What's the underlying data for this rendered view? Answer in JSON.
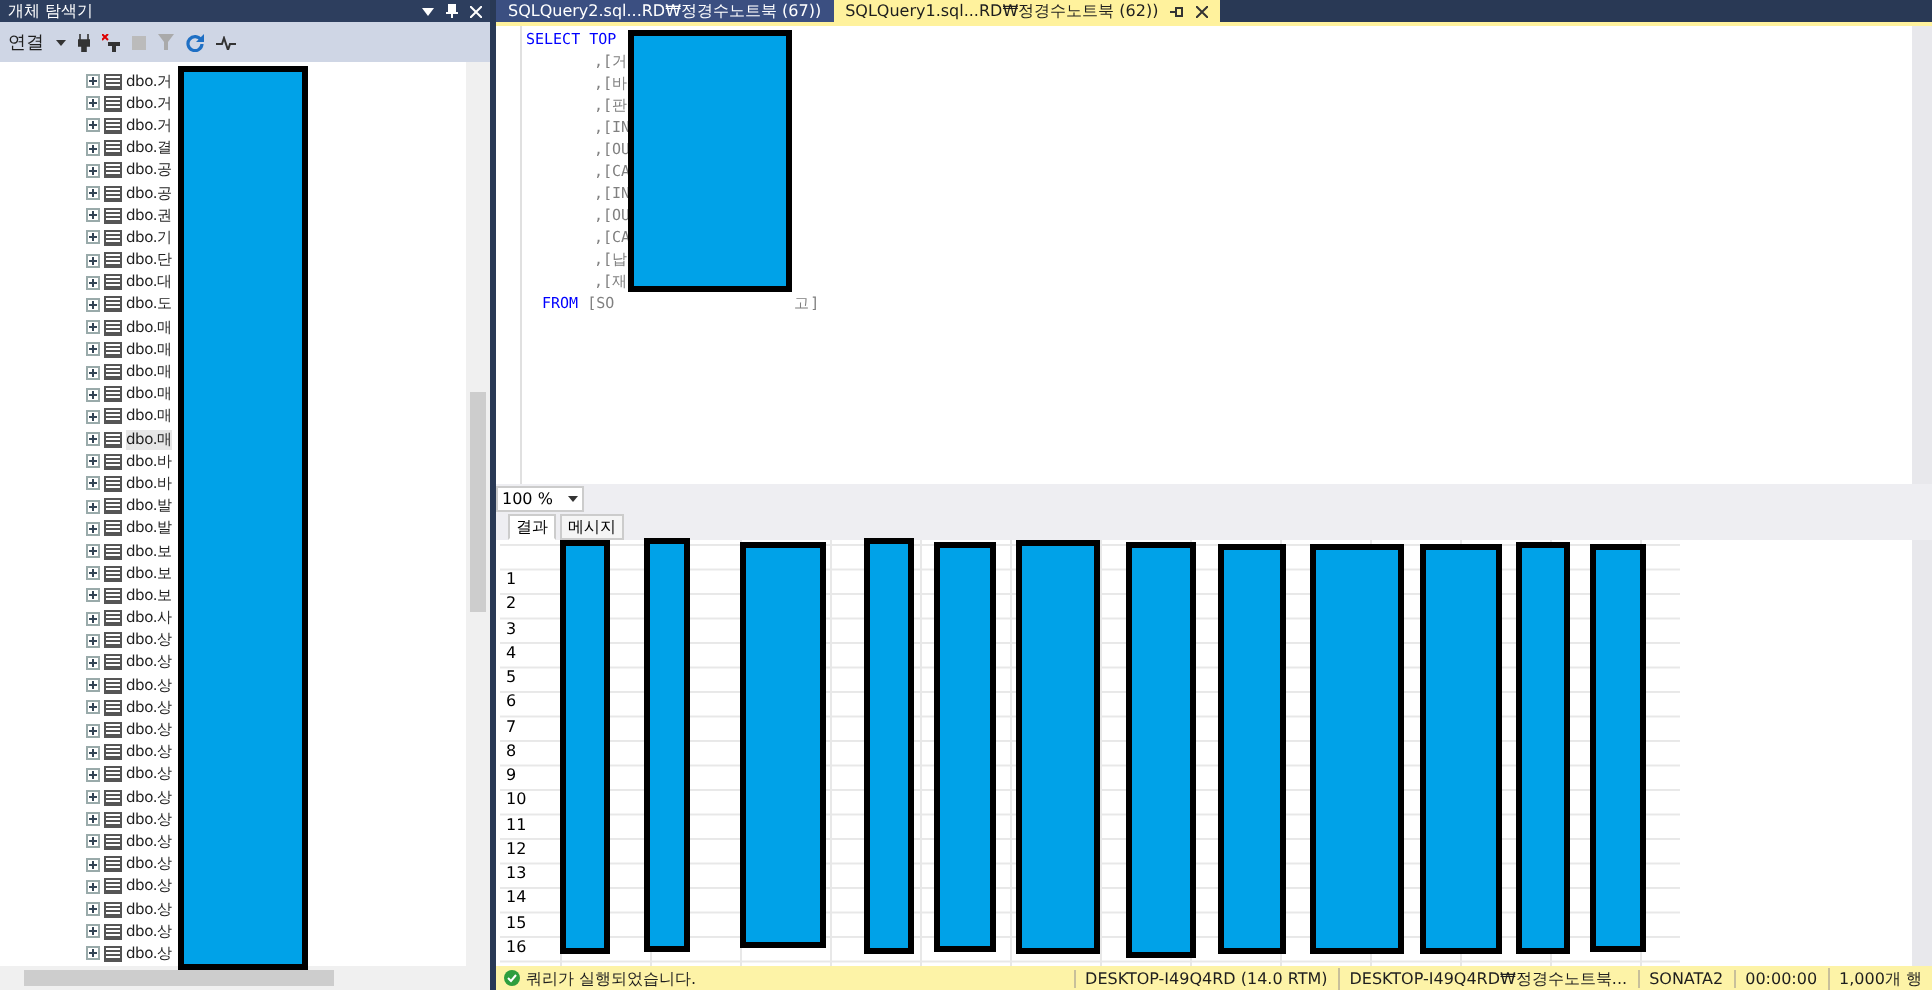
{
  "object_explorer": {
    "title": "개체 탐색기",
    "connect_label": "연결",
    "tree_items": [
      {
        "label": "dbo.거",
        "selected": false
      },
      {
        "label": "dbo.거",
        "selected": false
      },
      {
        "label": "dbo.거",
        "selected": false
      },
      {
        "label": "dbo.결",
        "selected": false
      },
      {
        "label": "dbo.공",
        "selected": false
      },
      {
        "label": "dbo.공",
        "selected": false
      },
      {
        "label": "dbo.권",
        "selected": false
      },
      {
        "label": "dbo.기",
        "selected": false
      },
      {
        "label": "dbo.단",
        "selected": false
      },
      {
        "label": "dbo.대",
        "selected": false
      },
      {
        "label": "dbo.도",
        "selected": false
      },
      {
        "label": "dbo.매",
        "selected": false
      },
      {
        "label": "dbo.매",
        "selected": false
      },
      {
        "label": "dbo.매",
        "selected": false
      },
      {
        "label": "dbo.매",
        "selected": false
      },
      {
        "label": "dbo.매",
        "selected": false
      },
      {
        "label": "dbo.매",
        "selected": true
      },
      {
        "label": "dbo.바",
        "selected": false
      },
      {
        "label": "dbo.바",
        "selected": false
      },
      {
        "label": "dbo.발",
        "selected": false
      },
      {
        "label": "dbo.발",
        "selected": false
      },
      {
        "label": "dbo.보",
        "selected": false
      },
      {
        "label": "dbo.보",
        "selected": false
      },
      {
        "label": "dbo.보",
        "selected": false
      },
      {
        "label": "dbo.사",
        "selected": false
      },
      {
        "label": "dbo.상",
        "selected": false
      },
      {
        "label": "dbo.상",
        "selected": false
      },
      {
        "label": "dbo.상",
        "selected": false
      },
      {
        "label": "dbo.상",
        "selected": false
      },
      {
        "label": "dbo.상",
        "selected": false
      },
      {
        "label": "dbo.상",
        "selected": false
      },
      {
        "label": "dbo.상",
        "selected": false
      },
      {
        "label": "dbo.상",
        "selected": false
      },
      {
        "label": "dbo.상",
        "selected": false
      },
      {
        "label": "dbo.상",
        "selected": false
      },
      {
        "label": "dbo.상",
        "selected": false
      },
      {
        "label": "dbo.상",
        "selected": false
      },
      {
        "label": "dbo.상",
        "selected": false
      },
      {
        "label": "dbo.상",
        "selected": false
      },
      {
        "label": "dbo.상",
        "selected": false
      }
    ]
  },
  "tabs": [
    {
      "label": "SQLQuery2.sql...RD₩정경수노트북 (67))",
      "selected": false
    },
    {
      "label": "SQLQuery1.sql...RD₩정경수노트북 (62))",
      "selected": true
    }
  ],
  "editor": {
    "first_line": {
      "keyword": "SELECT TOP"
    },
    "column_lines": [
      ",[거",
      ",[바",
      ",[판",
      ",[IN",
      ",[OU",
      ",[CA",
      ",[IN",
      ",[OU",
      ",[CA",
      ",[납",
      ",[재"
    ],
    "from_line": {
      "keyword": "FROM",
      "text": "[SO",
      "suffix": "고]"
    }
  },
  "zoom": "100 %",
  "result_tabs": [
    {
      "label": "결과",
      "selected": true
    },
    {
      "label": "메시지",
      "selected": false
    }
  ],
  "grid": {
    "row_numbers": [
      "1",
      "2",
      "3",
      "4",
      "5",
      "6",
      "7",
      "8",
      "9",
      "10",
      "11",
      "12",
      "13",
      "14",
      "15",
      "16"
    ]
  },
  "status_bar": {
    "message": "쿼리가 실행되었습니다.",
    "server": "DESKTOP-I49Q4RD (14.0 RTM)",
    "user": "DESKTOP-I49Q4RD₩정경수노트북...",
    "database": "SONATA2",
    "elapsed": "00:00:00",
    "rows": "1,000개 행"
  }
}
